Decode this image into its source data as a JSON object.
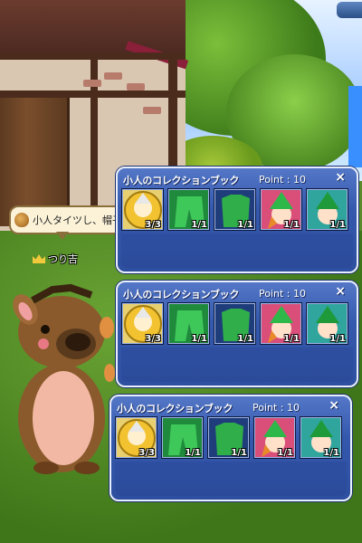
{
  "bubble": {
    "text": "小人タイツし、帽子し"
  },
  "player": {
    "name": "つり吉"
  },
  "panels": [
    {
      "title": "小人のコレクションブック",
      "point": "Point : 10",
      "close": "×",
      "items": [
        {
          "name": "gold-coin-gnome",
          "count": "3/3"
        },
        {
          "name": "green-tights-front",
          "count": "1/1"
        },
        {
          "name": "green-tights-back",
          "count": "1/1"
        },
        {
          "name": "green-hat-girl",
          "count": "1/1"
        },
        {
          "name": "green-hat-boy",
          "count": "1/1"
        }
      ]
    },
    {
      "title": "小人のコレクションブック",
      "point": "Point : 10",
      "close": "×",
      "items": [
        {
          "name": "gold-coin-gnome",
          "count": "3/3"
        },
        {
          "name": "green-tights-front",
          "count": "1/1"
        },
        {
          "name": "green-tights-back",
          "count": "1/1"
        },
        {
          "name": "green-hat-girl",
          "count": "1/1"
        },
        {
          "name": "green-hat-boy",
          "count": "1/1"
        }
      ]
    },
    {
      "title": "小人のコレクションブック",
      "point": "Point : 10",
      "close": "×",
      "items": [
        {
          "name": "gold-coin-gnome",
          "count": "3/3"
        },
        {
          "name": "green-tights-front",
          "count": "1/1"
        },
        {
          "name": "green-tights-back",
          "count": "1/1"
        },
        {
          "name": "green-hat-girl",
          "count": "1/1"
        },
        {
          "name": "green-hat-boy",
          "count": "1/1"
        }
      ]
    }
  ],
  "colors": {
    "panel": "#3458ad",
    "panel_border": "#e8eefc",
    "grass": "#4f8a22"
  }
}
